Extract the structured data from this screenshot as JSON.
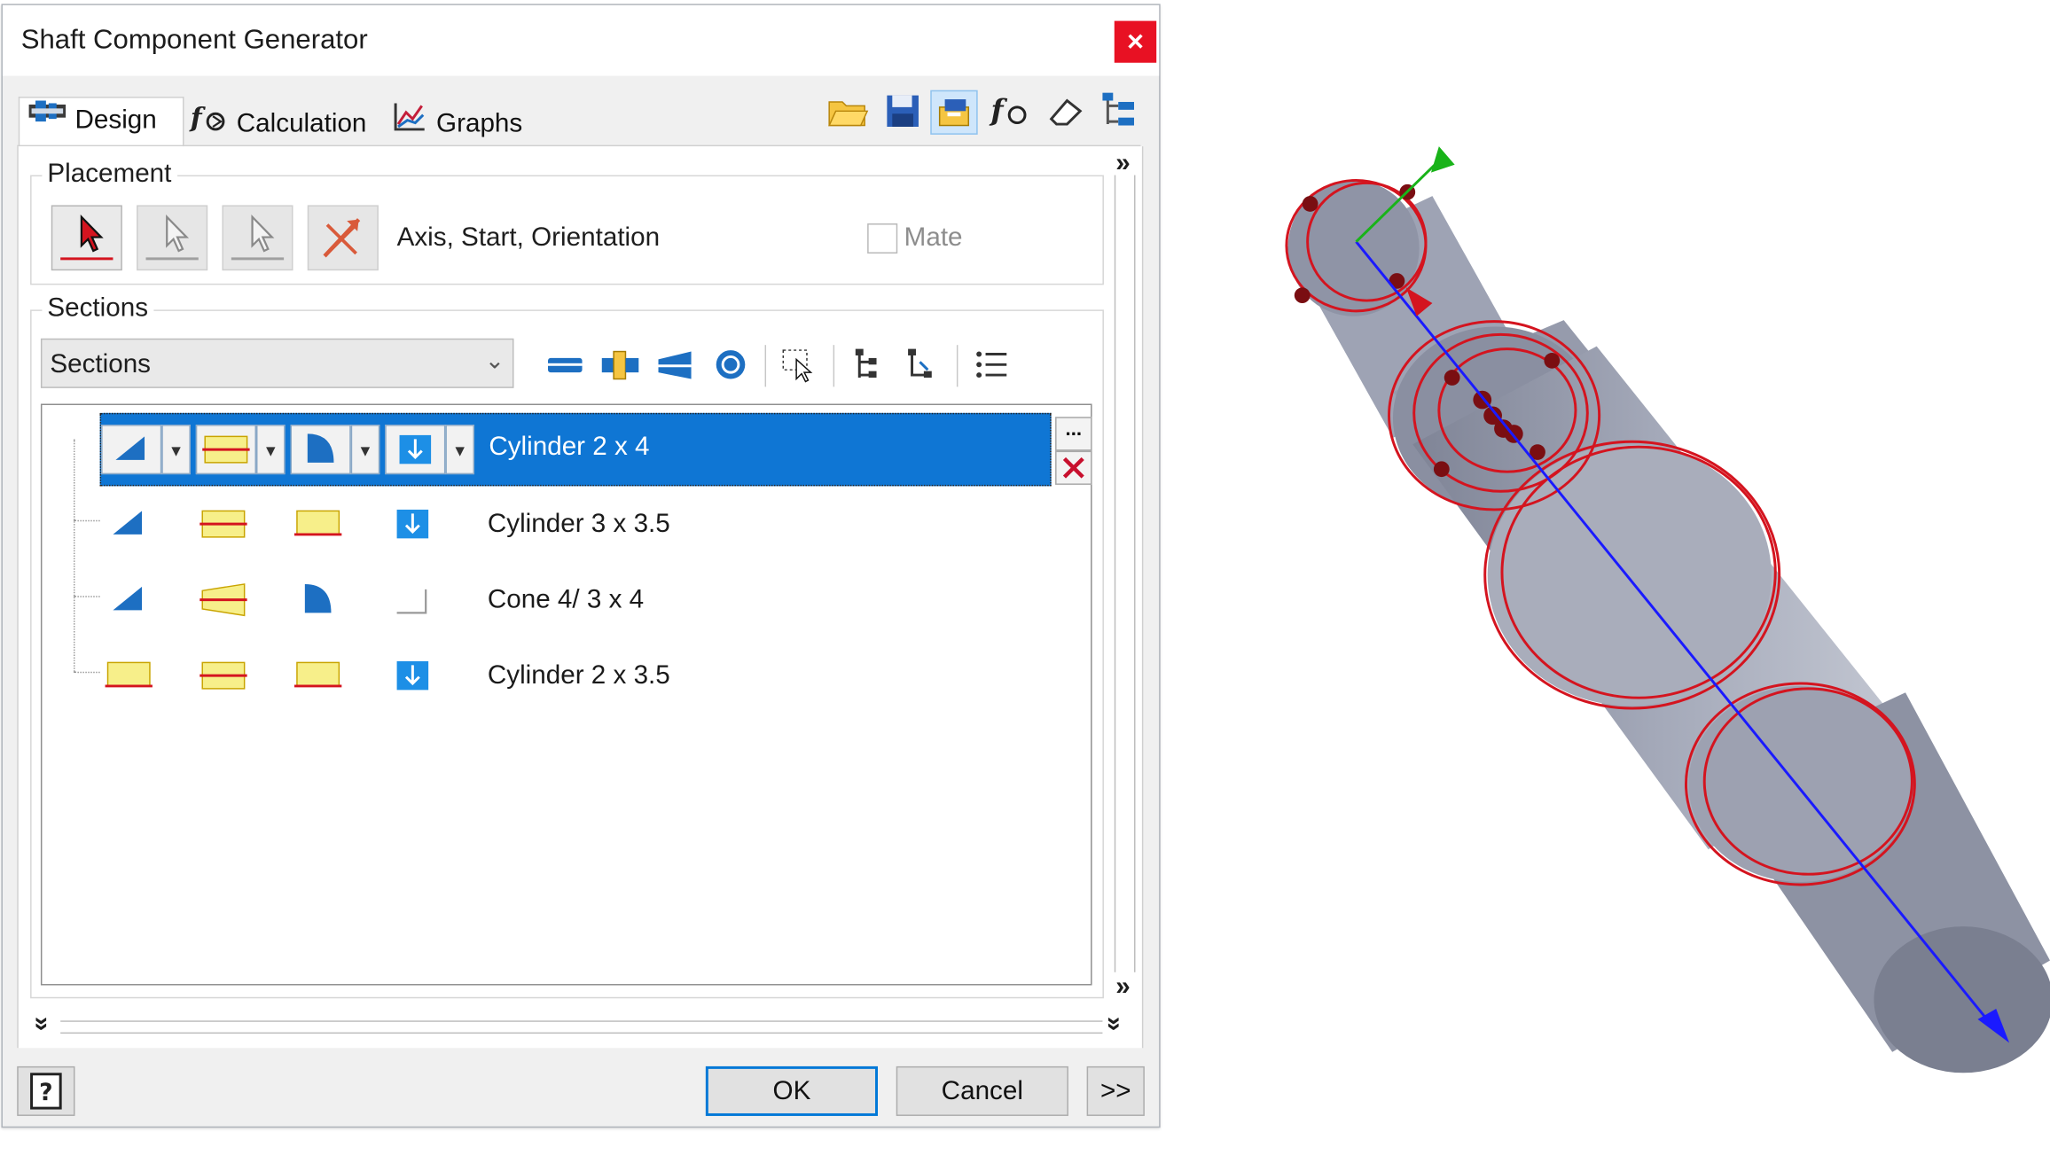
{
  "dialog": {
    "title": "Shaft Component Generator",
    "close_glyph": "×"
  },
  "tabs": [
    {
      "label": "Design",
      "icon": "design-icon",
      "active": true
    },
    {
      "label": "Calculation",
      "icon": "calculation-fx-icon",
      "active": false
    },
    {
      "label": "Graphs",
      "icon": "graphs-icon",
      "active": false
    }
  ],
  "toolbar_icons": [
    "open-folder-icon",
    "save-icon",
    "options-icon",
    "calculation-fx-icon",
    "eraser-icon",
    "tree-icon"
  ],
  "placement": {
    "group_label": "Placement",
    "selection_text": "Axis, Start, Orientation",
    "mate_label": "Mate",
    "mate_checked": false
  },
  "sections": {
    "group_label": "Sections",
    "combo_value": "Sections",
    "combo_arrow": "⌄",
    "toolbar_icons": [
      "insert-cylinder-icon",
      "insert-cone-icon",
      "insert-polygon-icon",
      "insert-polygon-2-icon",
      "select-icon",
      "tree-expand-icon",
      "tree-collapse-icon",
      "list-icon"
    ],
    "more_glyph": "...",
    "rows": [
      {
        "label": "Cylinder 2 x 4",
        "selected": true
      },
      {
        "label": "Cylinder 3 x 3.5",
        "selected": false
      },
      {
        "label": "Cone 4/ 3 x 4",
        "selected": false
      },
      {
        "label": "Cylinder 2 x 3.5",
        "selected": false
      }
    ]
  },
  "chevrons": {
    "right": "»",
    "down": "»"
  },
  "buttons": {
    "help_glyph": "?",
    "ok": "OK",
    "cancel": "Cancel",
    "more": ">>"
  },
  "colors": {
    "selection": "#0f76d4",
    "close": "#e81123",
    "shaft": "#9a9fb0",
    "edge": "#d4141f",
    "axis": "#1a1aff"
  }
}
